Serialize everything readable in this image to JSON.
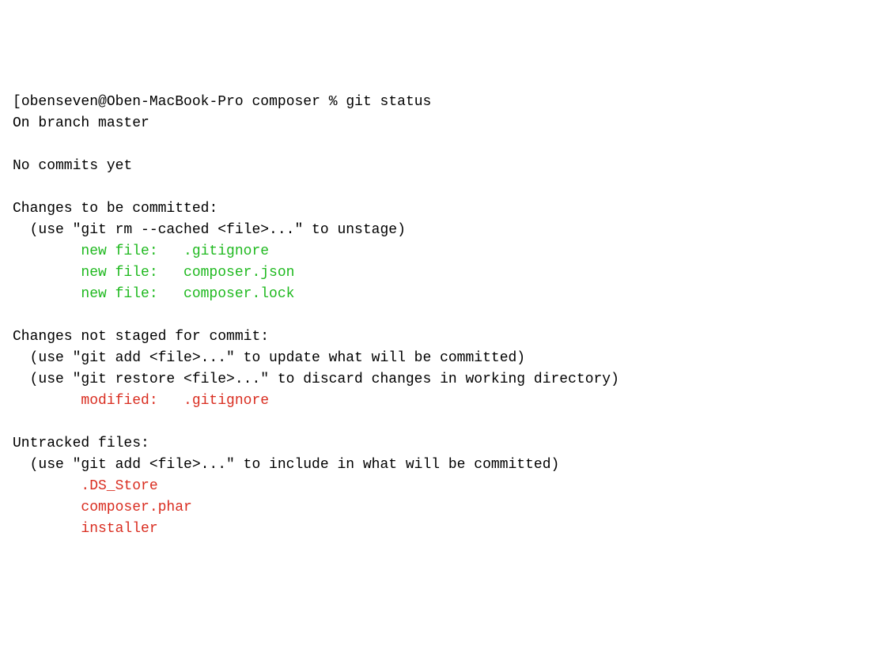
{
  "prompt": {
    "user": "obenseven",
    "host": "Oben-MacBook-Pro",
    "cwd": "composer",
    "symbol": "%",
    "command": "git status"
  },
  "branch_line": "On branch master",
  "no_commits": "No commits yet",
  "staged": {
    "header": "Changes to be committed:",
    "hint": "(use \"git rm --cached <file>...\" to unstage)",
    "files": [
      {
        "status": "new file:",
        "name": ".gitignore"
      },
      {
        "status": "new file:",
        "name": "composer.json"
      },
      {
        "status": "new file:",
        "name": "composer.lock"
      }
    ]
  },
  "unstaged": {
    "header": "Changes not staged for commit:",
    "hint1": "(use \"git add <file>...\" to update what will be committed)",
    "hint2": "(use \"git restore <file>...\" to discard changes in working directory)",
    "files": [
      {
        "status": "modified:",
        "name": ".gitignore"
      }
    ]
  },
  "untracked": {
    "header": "Untracked files:",
    "hint": "(use \"git add <file>...\" to include in what will be committed)",
    "files": [
      ".DS_Store",
      "composer.phar",
      "installer"
    ]
  },
  "colors": {
    "staged": "#1fb91f",
    "unstaged": "#d92d20",
    "untracked": "#d92d20"
  }
}
